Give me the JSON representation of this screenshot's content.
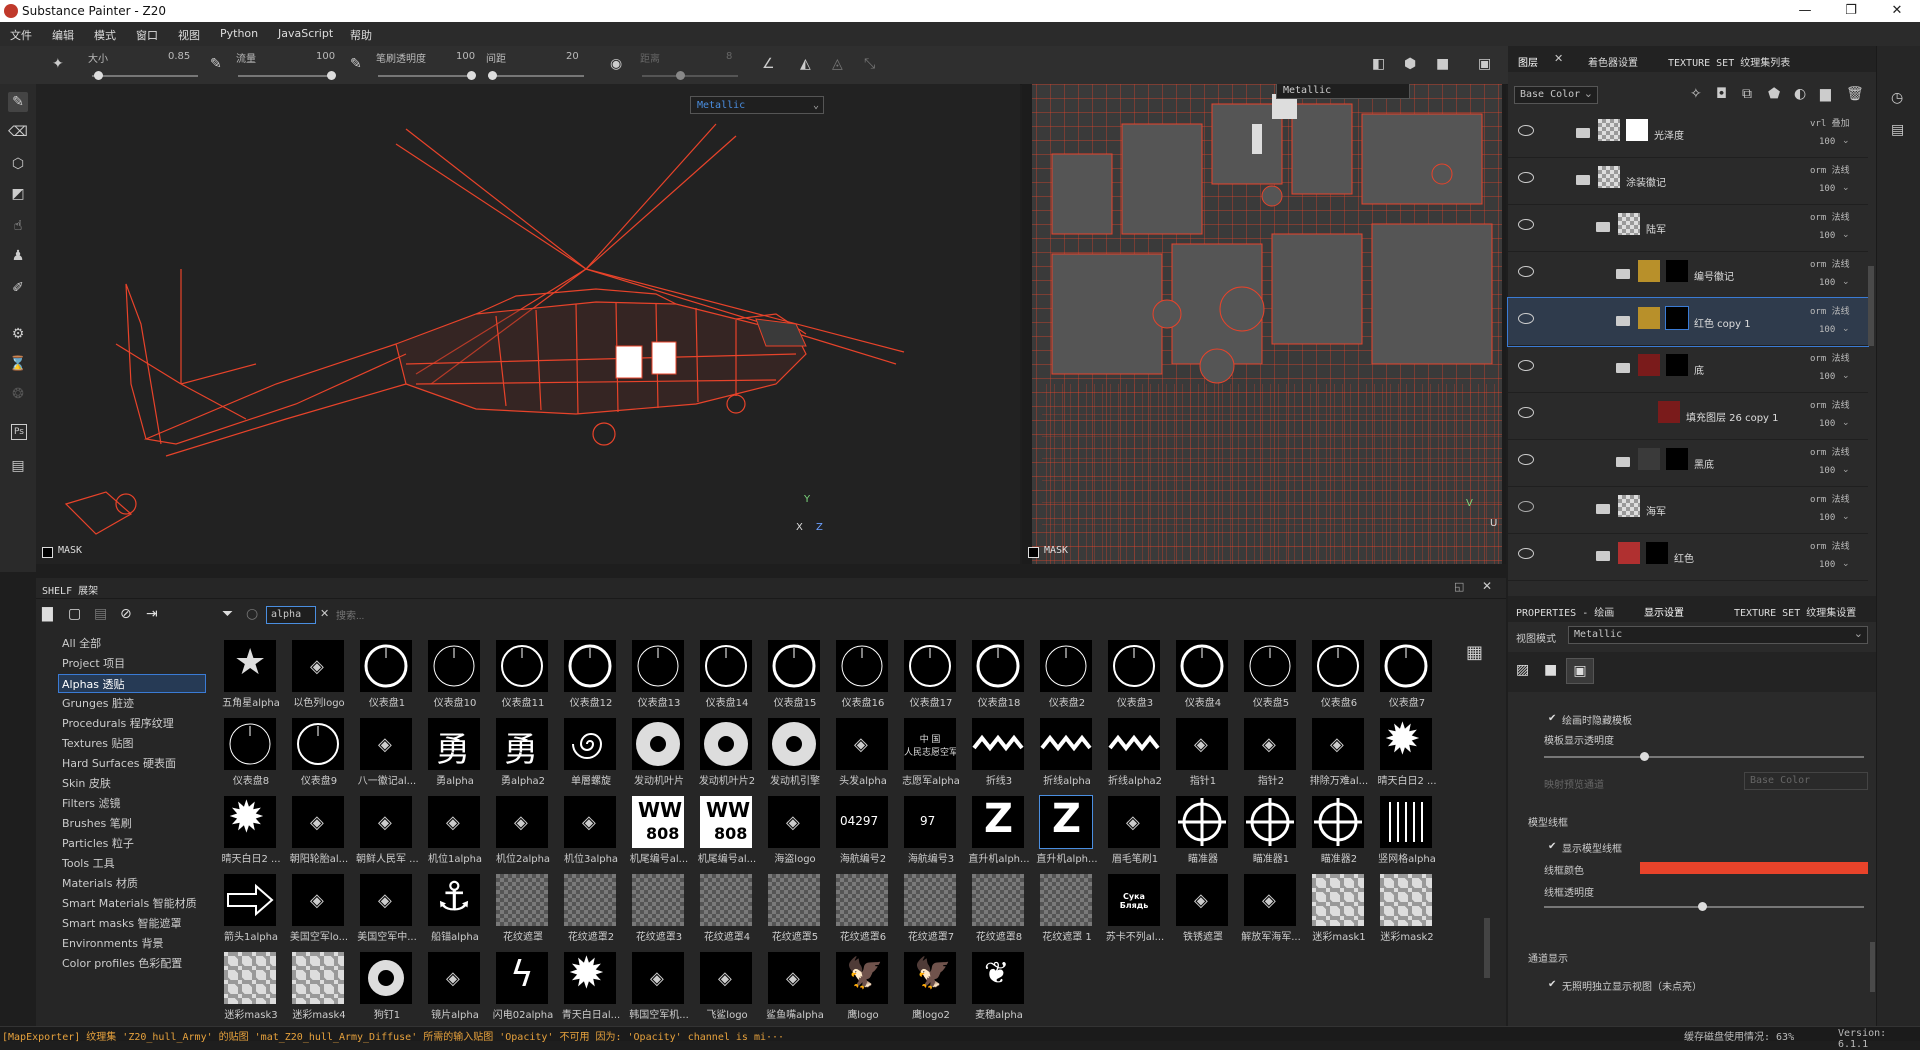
{
  "window": {
    "title": "Substance Painter - Z20"
  },
  "menu": [
    "文件",
    "编辑",
    "模式",
    "窗口",
    "视图",
    "Python",
    "JavaScript",
    "帮助"
  ],
  "toolbar": {
    "size_label": "大小",
    "size_value": "0.85",
    "flow_label": "流量",
    "flow_value": "100",
    "stroke_opacity_label": "笔刷透明度",
    "stroke_opacity_value": "100",
    "spacing_label": "间距",
    "spacing_value": "20",
    "jitter_label": "距离",
    "jitter_value": "8"
  },
  "viewport3d": {
    "channel": "Metallic",
    "mask_label": "MASK",
    "axis_y": "Y",
    "axis_x": "X",
    "axis_z": "Z"
  },
  "viewportuv": {
    "channel": "Metallic",
    "mask_label": "MASK",
    "axis_v": "V",
    "axis_u": "U"
  },
  "shelf": {
    "title": "SHELF 展架",
    "filter_tag": "alpha",
    "search_placeholder": "搜索...",
    "categories": [
      "All 全部",
      "Project 项目",
      "Alphas 透贴",
      "Grunges 脏迹",
      "Procedurals 程序纹理",
      "Textures 贴图",
      "Hard Surfaces 硬表面",
      "Skin 皮肤",
      "Filters 滤镜",
      "Brushes 笔刷",
      "Particles 粒子",
      "Tools 工具",
      "Materials 材质",
      "Smart Materials 智能材质",
      "Smart masks 智能遮罩",
      "Environments 背景",
      "Color profiles 色彩配置"
    ],
    "selected_category": 2,
    "items": [
      "五角星alpha",
      "以色列logo",
      "仪表盘1",
      "仪表盘10",
      "仪表盘11",
      "仪表盘12",
      "仪表盘13",
      "仪表盘14",
      "仪表盘15",
      "仪表盘16",
      "仪表盘17",
      "仪表盘18",
      "仪表盘2",
      "仪表盘3",
      "仪表盘4",
      "仪表盘5",
      "仪表盘6",
      "仪表盘7",
      "仪表盘8",
      "仪表盘9",
      "八一徽记al...",
      "勇alpha",
      "勇alpha2",
      "单層螺旋",
      "发动机叶片",
      "发动机叶片2",
      "发动机引擎",
      "头发alpha",
      "志愿军alpha",
      "折线3",
      "折线alpha",
      "折线alpha2",
      "指针1",
      "指针2",
      "排除万难al...",
      "晴天白日2 ...",
      "晴天白日2 ...",
      "朝阳轮胎al...",
      "朝鲜人民军 ...",
      "机位1alpha",
      "机位2alpha",
      "机位3alpha",
      "机尾编号al...",
      "机尾编号al...",
      "海盗logo",
      "海航编号2",
      "海航编号3",
      "直升机alph...",
      "直升机alph...",
      "眉毛笔刷1",
      "瞄准器",
      "瞄准器1",
      "瞄准器2",
      "竖网格alpha",
      "箭头1alpha",
      "美国空军lo...",
      "美国空军中...",
      "船锚alpha",
      "花纹遮罩",
      "花纹遮罩2",
      "花纹遮罩3",
      "花纹遮罩4",
      "花纹遮罩5",
      "花纹遮罩6",
      "花纹遮罩7",
      "花纹遮罩8",
      "花纹遮罩 1",
      "苏卡不列al...",
      "铁锈遮罩",
      "解放军海军...",
      "迷彩mask1",
      "迷彩mask2",
      "迷彩mask3",
      "迷彩mask4",
      "狗钉1",
      "镜片alpha",
      "闪电02alpha",
      "青天白日al...",
      "韩国空军机...",
      "飞鲨logo",
      "鲨鱼嘴alpha",
      "鹰logo",
      "鹰logo2",
      "麦穗alpha"
    ],
    "selected_item": 48,
    "thumb_text": {
      "ww_top": "WW",
      "ww_bottom": "808",
      "hull1": "04297",
      "hull2": "97",
      "volunteer": "中 国\n人民志愿空军",
      "suka": "Сука Блядь",
      "brave": "勇",
      "z": "Z"
    }
  },
  "layers_panel": {
    "tabs": [
      "图层",
      "着色器设置",
      "TEXTURE SET 纹理集列表"
    ],
    "channel": "Base Color",
    "layers": [
      {
        "name": "光泽度",
        "blend": "vrl 叠加",
        "opacity": "100",
        "indent": 0,
        "type": "folder",
        "color": "#ffffff",
        "visible": true,
        "checker": true
      },
      {
        "name": "涂装徽记",
        "blend": "orm 法线",
        "opacity": "100",
        "indent": 0,
        "type": "folder-open",
        "color": "",
        "visible": true,
        "checker": true
      },
      {
        "name": "陆军",
        "blend": "orm 法线",
        "opacity": "100",
        "indent": 1,
        "type": "folder-open",
        "color": "",
        "visible": true,
        "checker": true
      },
      {
        "name": "编号徽记",
        "blend": "orm 法线",
        "opacity": "100",
        "indent": 2,
        "type": "folder",
        "color": "#b8902a",
        "visible": true,
        "checker": false
      },
      {
        "name": "红色 copy 1",
        "blend": "orm 法线",
        "opacity": "100",
        "indent": 2,
        "type": "folder",
        "color": "#b8902a",
        "visible": true,
        "checker": false,
        "selected": true
      },
      {
        "name": "底",
        "blend": "orm 法线",
        "opacity": "100",
        "indent": 2,
        "type": "folder-open",
        "color": "#7a1b1b",
        "visible": true,
        "checker": false
      },
      {
        "name": "填充图层 26 copy 1",
        "blend": "orm 法线",
        "opacity": "100",
        "indent": 3,
        "type": "fill",
        "color": "#7a1b1b",
        "visible": true,
        "checker": false
      },
      {
        "name": "黑底",
        "blend": "orm 法线",
        "opacity": "100",
        "indent": 2,
        "type": "folder",
        "color": "#3a3a3a",
        "visible": true,
        "checker": false
      },
      {
        "name": "海军",
        "blend": "orm 法线",
        "opacity": "100",
        "indent": 1,
        "type": "folder",
        "color": "",
        "visible": false,
        "checker": true
      },
      {
        "name": "红色",
        "blend": "orm 法线",
        "opacity": "100",
        "indent": 1,
        "type": "folder-open",
        "color": "#b03030",
        "visible": true,
        "checker": false
      }
    ]
  },
  "properties_panel": {
    "tabs": [
      "PROPERTIES - 绘画",
      "显示设置",
      "TEXTURE SET 纹理集设置"
    ],
    "view_mode_label": "视图模式",
    "view_mode_value": "Metallic",
    "hide_while_paint": "绘画时隐藏模板",
    "template_opacity_label": "模板显示透明度",
    "channel_label": "映射预览通道",
    "channel_value": "Base Color",
    "wire_section": "模型线框",
    "show_wire": "显示模型线框",
    "wire_color_label": "线框颜色",
    "wire_opacity_label": "线框透明度",
    "channel_section": "通道显示",
    "isolate": "无照明独立显示视图（未点亮）",
    "wire_color": "#e8432a"
  },
  "status": {
    "message": "[MapExporter] 纹理集 'Z20_hull_Army' 的贴图 'mat_Z20_hull_Army_Diffuse' 所需的输入贴图 'Opacity' 不可用 因为: 'Opacity' channel is mi···",
    "cache": "缓存磁盘使用情况: 63%",
    "version": "Version: 6.1.1"
  },
  "colors": {
    "wire": "#e8432a",
    "accent": "#3a7bd5"
  }
}
